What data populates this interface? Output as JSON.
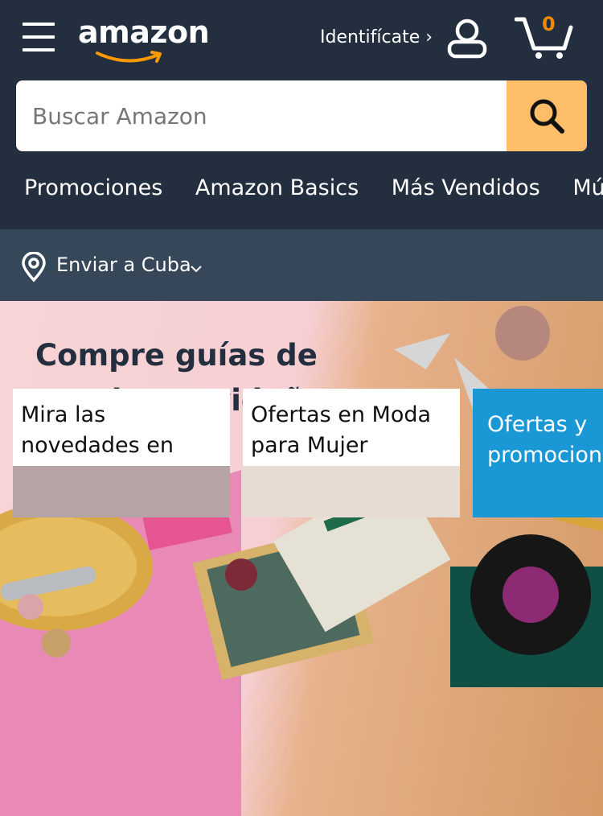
{
  "header": {
    "logo_text": "amazon",
    "signin_label": "Identifícate ›",
    "cart_count": "0",
    "icons": [
      "menu-icon",
      "user-icon",
      "cart-icon",
      "search-icon",
      "location-pin-icon",
      "chevron-down-icon"
    ]
  },
  "search": {
    "placeholder": "Buscar Amazon",
    "value": ""
  },
  "nav": {
    "items": [
      "Promociones",
      "Amazon Basics",
      "Más Vendidos",
      "Mús"
    ]
  },
  "location": {
    "label": "Enviar a Cuba"
  },
  "hero": {
    "title": "Compre guías de regalos navideños"
  },
  "cards": [
    {
      "title": "Mira las novedades en Hogar"
    },
    {
      "title": "Ofertas en Moda para Mujer"
    },
    {
      "title": "Ofertas y promocione"
    }
  ],
  "colors": {
    "header_bg": "#232f3e",
    "subnav_bg": "#37475a",
    "search_button": "#febd69",
    "cart_count": "#f08804",
    "accent": "#ff9900"
  }
}
